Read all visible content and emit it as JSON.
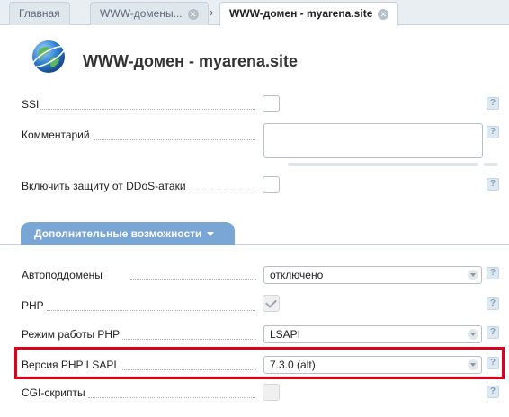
{
  "tabs": {
    "home": "Главная",
    "domains": "WWW-домены...",
    "current": "WWW-домен - myarena.site"
  },
  "header": {
    "title": "WWW-домен - myarena.site"
  },
  "fields": {
    "ssi": "SSI",
    "comment": "Комментарий",
    "ddos": "Включить защиту от DDoS-атаки"
  },
  "section": {
    "label": "Дополнительные возможности"
  },
  "advanced": {
    "subdomains": {
      "label": "Автоподдомены",
      "value": "отключено"
    },
    "php": {
      "label": "PHP",
      "checked": true
    },
    "php_mode": {
      "label": "Режим работы PHP",
      "value": "LSAPI"
    },
    "php_version": {
      "label": "Версия PHP LSAPI",
      "value": "7.3.0 (alt)"
    },
    "cgi": {
      "label": "CGI-скрипты"
    }
  },
  "help_glyph": "?",
  "colors": {
    "accent": "#7aa6d6",
    "highlight": "#e0001a"
  }
}
